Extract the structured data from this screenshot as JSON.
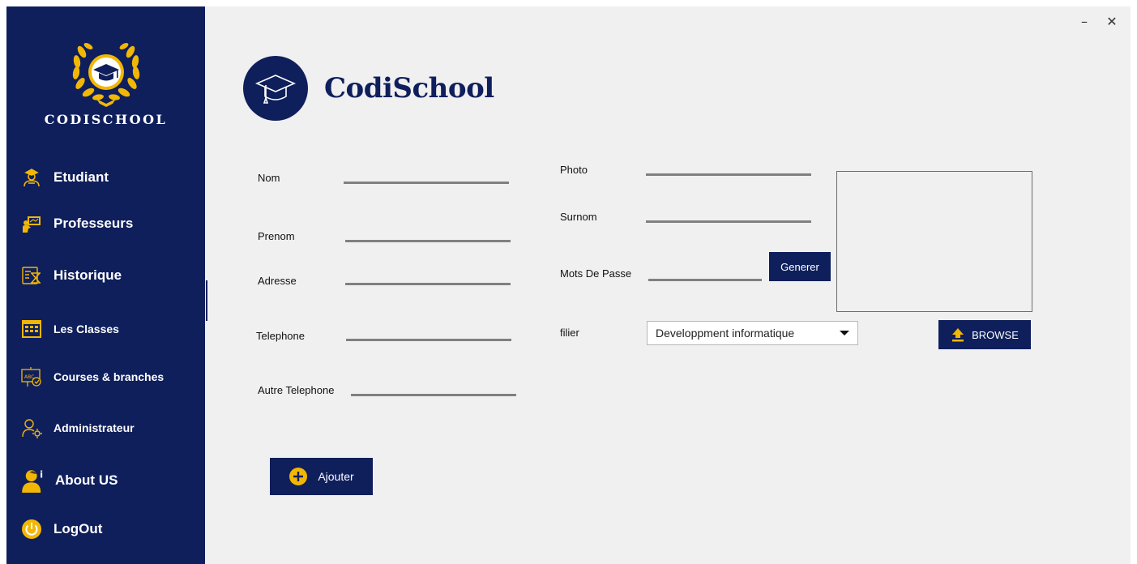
{
  "window": {
    "minimize_symbol": "–",
    "close_symbol": "✕"
  },
  "sidebar": {
    "logo_text": "CODISCHOOL",
    "items": [
      {
        "label": "Etudiant",
        "icon": "student-icon"
      },
      {
        "label": "Professeurs",
        "icon": "teacher-board-icon"
      },
      {
        "label": "Historique",
        "icon": "history-icon"
      },
      {
        "label": "Les Classes",
        "icon": "classroom-icon"
      },
      {
        "label": "Courses & branches",
        "icon": "abc-board-icon"
      },
      {
        "label": "Administrateur",
        "icon": "admin-icon"
      },
      {
        "label": "About US",
        "icon": "user-info-icon"
      },
      {
        "label": "LogOut",
        "icon": "power-icon"
      }
    ]
  },
  "brand": {
    "title": "CodiSchool",
    "icon": "graduation-cap-icon"
  },
  "form": {
    "nom_label": "Nom",
    "prenom_label": "Prenom",
    "adresse_label": "Adresse",
    "telephone_label": "Telephone",
    "autre_telephone_label": "Autre Telephone",
    "photo_label": "Photo",
    "surnom_label": "Surnom",
    "mots_de_passe_label": "Mots De Passe",
    "filier_label": "filier",
    "filier_value": "Developpment informatique",
    "generer_label": "Generer",
    "browse_label": "BROWSE",
    "ajouter_label": "Ajouter"
  },
  "colors": {
    "navy": "#0f1f5c",
    "gold": "#f2b705",
    "background": "#f0f0f0",
    "underline": "#808080"
  }
}
